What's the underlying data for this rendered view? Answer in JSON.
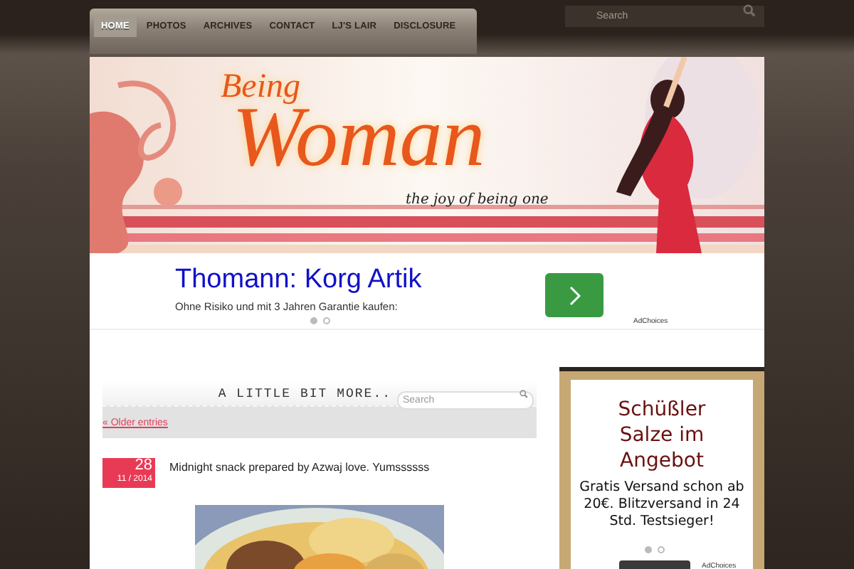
{
  "nav": {
    "tabs": [
      {
        "label": "HOME",
        "selected": true
      },
      {
        "label": "PHOTOS",
        "selected": false
      },
      {
        "label": "ARCHIVES",
        "selected": false
      },
      {
        "label": "CONTACT",
        "selected": false
      },
      {
        "label": "LJ'S LAIR",
        "selected": false
      },
      {
        "label": "DISCLOSURE",
        "selected": false
      }
    ],
    "search": {
      "placeholder": "Search"
    }
  },
  "banner": {
    "title_small": "Being",
    "title_large": "Woman",
    "tagline": "the joy of being one"
  },
  "ad": {
    "headline": "Thomann: Korg Artik",
    "body": "Ohne Risiko und mit 3 Jahren Garantie kaufen:",
    "dots": [
      {
        "selected": true
      },
      {
        "selected": false
      }
    ],
    "adchoices": "AdChoices"
  },
  "main": {
    "heading": "A LITTLE BIT MORE..",
    "search": {
      "placeholder": "Search"
    },
    "older_link": "« Older entries",
    "post": {
      "day": "28",
      "month_year": "11 / 2014",
      "title": "Midnight snack prepared by Azwaj love. Yumssssss"
    }
  },
  "sidebar_ad": {
    "title": "Schüßler Salze im Angebot",
    "body": "Gratis Versand schon ab 20€. Blitzversand in 24 Std. Testsieger!",
    "dots": [
      {
        "selected": true
      },
      {
        "selected": false
      }
    ],
    "adchoices": "AdChoices"
  }
}
